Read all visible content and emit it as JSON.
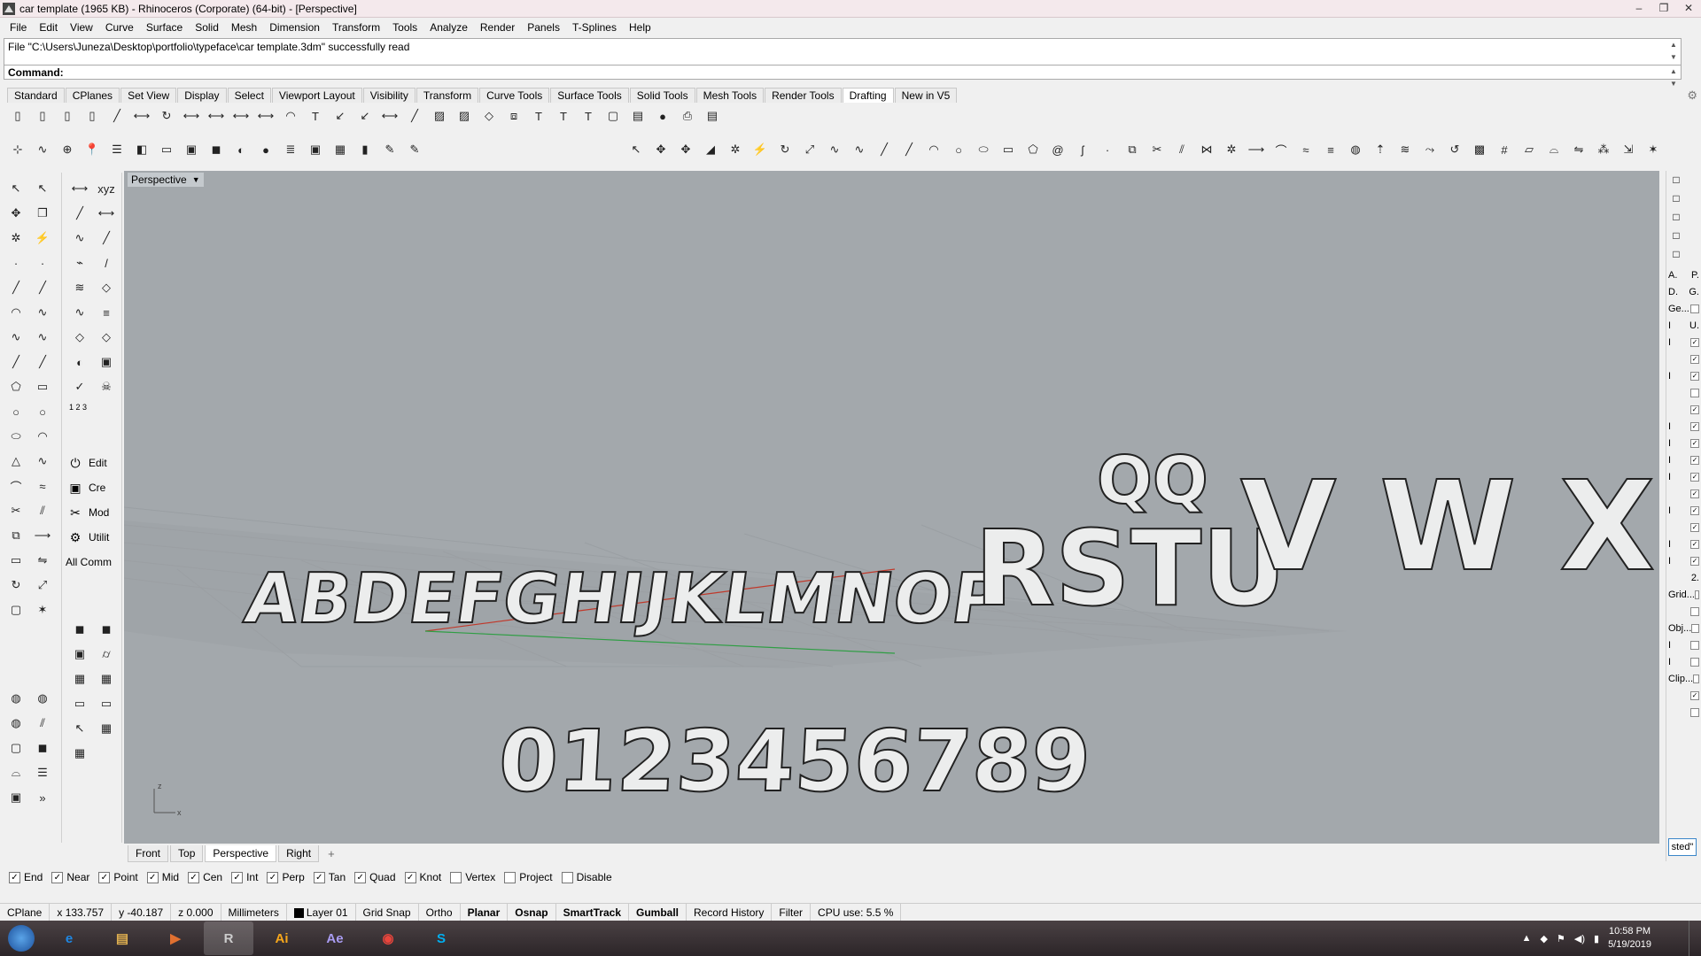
{
  "window": {
    "title": "car template (1965 KB) - Rhinoceros (Corporate) (64-bit) - [Perspective]",
    "controls": [
      "–",
      "❐",
      "✕"
    ]
  },
  "menu": [
    "File",
    "Edit",
    "View",
    "Curve",
    "Surface",
    "Solid",
    "Mesh",
    "Dimension",
    "Transform",
    "Tools",
    "Analyze",
    "Render",
    "Panels",
    "T-Splines",
    "Help"
  ],
  "command": {
    "history": "File \"C:\\Users\\Juneza\\Desktop\\portfolio\\typeface\\car template.3dm\" successfully read",
    "prompt": "Command:",
    "value": ""
  },
  "toolbar_tabs": {
    "items": [
      "Standard",
      "CPlanes",
      "Set View",
      "Display",
      "Select",
      "Viewport Layout",
      "Visibility",
      "Transform",
      "Curve Tools",
      "Surface Tools",
      "Solid Tools",
      "Mesh Tools",
      "Render Tools",
      "Drafting",
      "New in V5"
    ],
    "active": "Drafting"
  },
  "toolbar_row1_icons": [
    "new-sheet-icon",
    "page-icon",
    "page-two-icon",
    "page-stack-icon",
    "dimension-linear-icon",
    "dimension-aligned-icon",
    "dimension-rotated-icon",
    "dimension-ordinate-icon",
    "dimension-angle-icon",
    "dimension-radius-icon",
    "dimension-diameter-icon",
    "dimension-arc-icon",
    "text-icon",
    "leader-icon",
    "leader-multi-icon",
    "dimension-chain-icon",
    "dimension-baseline-icon",
    "hatch-icon",
    "hatch-fill-icon",
    "clipping-plane-icon",
    "make2d-icon",
    "text-block-icon",
    "text-object-icon",
    "text-field-icon",
    "box-drawing-icon",
    "table-icon",
    "sphere-render-icon",
    "print-icon",
    "layout-icon"
  ],
  "toolbar_row2_icons": [
    "osnap-snap-icon",
    "curve-icon",
    "gumball-icon",
    "pushpin-icon",
    "layer-icon",
    "material-icon",
    "rectangle-icon",
    "cube-icon",
    "solid-cube-icon",
    "rainbow-icon",
    "sphere-icon",
    "stack-icon",
    "cube-red-icon",
    "grid-icon",
    "bar-icon",
    "pen-icon",
    "pencil-icon"
  ],
  "toolbar_row2b_icons": [
    "select-arrow-icon",
    "move-icon",
    "move-gumball-icon",
    "bevel-icon",
    "explode-icon",
    "lightning-icon",
    "rotate-icon",
    "scale-icon",
    "curve-fillet-icon",
    "curve-chamfer-icon",
    "line-icon",
    "polyline-icon",
    "arc-icon",
    "circle-icon",
    "ellipse-icon",
    "rectangle-icon",
    "polygon-icon",
    "spiral-icon",
    "helix-icon",
    "point-icon",
    "offset-icon",
    "trim-icon",
    "split-icon",
    "join-icon",
    "explode-curve-icon",
    "extend-icon",
    "fillet-icon",
    "blend-icon",
    "match-icon",
    "boolean-icon",
    "extrude-icon",
    "loft-icon",
    "sweep-icon",
    "revolve-icon",
    "patch-icon",
    "network-icon",
    "planar-icon",
    "cap-icon",
    "mirror-icon",
    "array-icon",
    "orient-icon",
    "star-icon"
  ],
  "leftbar1_icons": [
    "select-icon",
    "select-window-icon",
    "move-icon",
    "copy-icon",
    "explode-icon",
    "lightning-icon",
    "point-icon",
    "point-grid-icon",
    "line-icon",
    "polyline-icon",
    "arc-icon",
    "curve-icon",
    "curve-control-icon",
    "curve-interpolate-icon",
    "line-segment-icon",
    "line-tangent-icon",
    "polygon-icon",
    "rectangle-icon",
    "circle-icon",
    "circle-3pt-icon",
    "ellipse-icon",
    "arc-3pt-icon",
    "triangle-icon",
    "curve-free-icon",
    "fillet-icon",
    "blend-icon",
    "trim-icon",
    "split-icon",
    "offset-icon",
    "extend-icon",
    "rectangle-plane-icon",
    "mirror-icon",
    "rotate-icon",
    "scale-icon",
    "box-icon",
    "star-icon"
  ],
  "leftbar1_bottom_icons": [
    "boolean-union-icon",
    "boolean-difference-icon",
    "boolean-intersect-icon",
    "boolean-split-icon",
    "solid-box-icon",
    "solid-cylinder-icon",
    "cap-icon",
    "layers-icon",
    "cube-blue-icon"
  ],
  "leftbar1_more": "»",
  "leftbar2_icons": [
    "dimension-icon",
    "xyz-icon",
    "dimension-linear-icon",
    "dimension-angle-icon",
    "curve-edit-icon",
    "line-edit-icon",
    "curvature-icon",
    "slash-icon",
    "loft-icon",
    "plane-icon",
    "blend-curve-icon",
    "match-icon",
    "plane-divide-icon",
    "cplane-icon",
    "rainbow-icon",
    "cube-red-icon",
    "check-icon",
    "skull-icon"
  ],
  "leftbar2_label_123": "1 2 3",
  "leftbar2_commands": [
    {
      "icon": "power-icon",
      "label": "Edit"
    },
    {
      "icon": "cube-pink-icon",
      "label": "Cre"
    },
    {
      "icon": "tools-pink-icon",
      "label": "Mod"
    },
    {
      "icon": "utility-icon",
      "label": "Utilit"
    },
    {
      "icon": "",
      "label": "All Comm"
    }
  ],
  "leftbar2_bottom_icons": [
    "solid-cube-icon",
    "solid-cube-edit-icon",
    "extrude-cube-icon",
    "cylinder-icon",
    "mesh-icon",
    "mesh-edit-icon",
    "yellow-frame-icon",
    "yellow-frame-edit-icon",
    "pink-arrow-icon",
    "pink-grid-icon",
    "pink-mesh-icon"
  ],
  "viewport": {
    "label": "Perspective",
    "letters_row1": "ABDEFGHIJKLMNOP",
    "letters_row2": "RSTU",
    "letters_row2_top": "QQ",
    "letters_row3": "V W X Y",
    "numbers": "0123456789",
    "axis_x": "x",
    "axis_z": "z",
    "bg_color": "#a3a8ac",
    "x_axis_color": "#c0392b",
    "y_axis_color": "#2f9e44"
  },
  "view_tabs": {
    "items": [
      "Front",
      "Top",
      "Perspective",
      "Right"
    ],
    "active": "Perspective",
    "add": "+"
  },
  "right_panel": {
    "top_icons": [
      "color-wheel-icon",
      "render-icon",
      "shield-icon",
      "monitor-icon",
      "gear-icon"
    ],
    "rows": [
      {
        "label": "A.",
        "right": "P."
      },
      {
        "label": "D.",
        "right": "G."
      },
      {
        "label": "Ge...",
        "right": ""
      },
      {
        "label": "I",
        "right": "U."
      },
      {
        "label": "I",
        "right": "✓"
      },
      {
        "label": "",
        "right": "✓"
      },
      {
        "label": "I",
        "right": "✓"
      },
      {
        "label": "",
        "right": ""
      },
      {
        "label": "",
        "right": "✓"
      },
      {
        "label": "I",
        "right": "✓"
      },
      {
        "label": "I",
        "right": "✓"
      },
      {
        "label": "I",
        "right": "✓"
      },
      {
        "label": "I",
        "right": "✓"
      },
      {
        "label": "",
        "right": "✓"
      },
      {
        "label": "I",
        "right": "✓"
      },
      {
        "label": "",
        "right": "✓"
      },
      {
        "label": "I",
        "right": "✓"
      },
      {
        "label": "I",
        "right": "✓"
      },
      {
        "label": "",
        "right": "2."
      },
      {
        "label": "Grid...",
        "right": ""
      },
      {
        "label": "",
        "right": ""
      },
      {
        "label": "Obj...",
        "right": ""
      },
      {
        "label": "I",
        "right": ""
      },
      {
        "label": "I",
        "right": ""
      },
      {
        "label": "Clip...",
        "right": ""
      },
      {
        "label": "",
        "right": "✓"
      },
      {
        "label": "",
        "right": ""
      }
    ],
    "bottom_button": "sted\""
  },
  "osnaps": [
    {
      "label": "End",
      "checked": true
    },
    {
      "label": "Near",
      "checked": true
    },
    {
      "label": "Point",
      "checked": true
    },
    {
      "label": "Mid",
      "checked": true
    },
    {
      "label": "Cen",
      "checked": true
    },
    {
      "label": "Int",
      "checked": true
    },
    {
      "label": "Perp",
      "checked": true
    },
    {
      "label": "Tan",
      "checked": true
    },
    {
      "label": "Quad",
      "checked": true
    },
    {
      "label": "Knot",
      "checked": true
    },
    {
      "label": "Vertex",
      "checked": false
    },
    {
      "label": "Project",
      "checked": false
    },
    {
      "label": "Disable",
      "checked": false
    }
  ],
  "status": {
    "cplane": "CPlane",
    "x": "x 133.757",
    "y": "y -40.187",
    "z": "z 0.000",
    "units": "Millimeters",
    "layer": "Layer 01",
    "grid_snap": "Grid Snap",
    "ortho": "Ortho",
    "planar": "Planar",
    "osnap": "Osnap",
    "smarttrack": "SmartTrack",
    "gumball": "Gumball",
    "record_history": "Record History",
    "filter": "Filter",
    "cpu": "CPU use: 5.5 %"
  },
  "taskbar": {
    "apps": [
      {
        "name": "internet-explorer-icon",
        "label": "e",
        "color": "#1e88e5"
      },
      {
        "name": "file-explorer-icon",
        "label": "▤",
        "color": "#e0b050"
      },
      {
        "name": "media-player-icon",
        "label": "▶",
        "color": "#e07030"
      },
      {
        "name": "rhino-icon",
        "label": "R",
        "color": "#cccccc"
      },
      {
        "name": "illustrator-icon",
        "label": "Ai",
        "color": "#f7a71b"
      },
      {
        "name": "after-effects-icon",
        "label": "Ae",
        "color": "#a99cf2"
      },
      {
        "name": "chrome-icon",
        "label": "◉",
        "color": "#e8453c"
      },
      {
        "name": "skype-icon",
        "label": "S",
        "color": "#00aff0"
      }
    ],
    "tray_up": "▲",
    "time": "10:58 PM",
    "date": "5/19/2019"
  }
}
